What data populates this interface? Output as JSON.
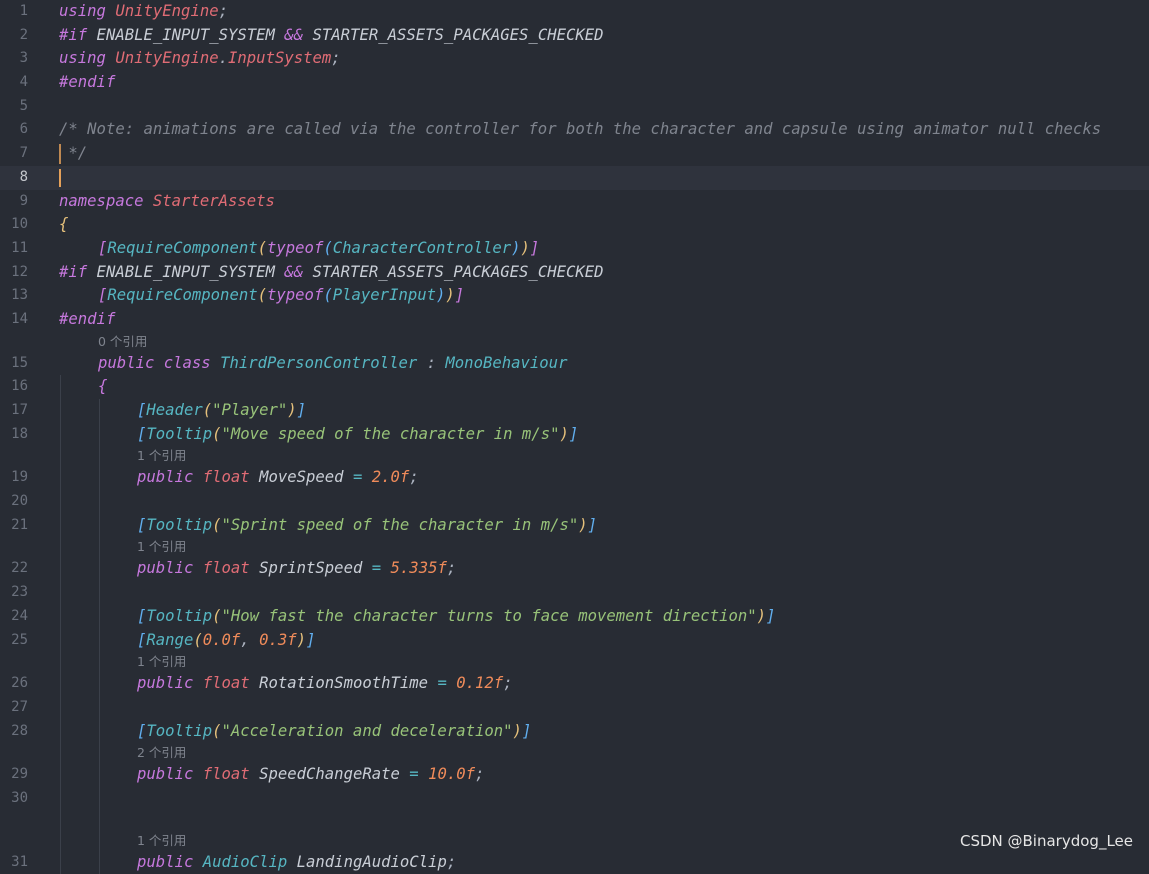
{
  "editor": {
    "current_line": "8",
    "lines": [
      {
        "num": "1",
        "indent": 0,
        "tokens": [
          {
            "t": "using",
            "c": "#c678dd"
          },
          {
            "t": " "
          },
          {
            "t": "UnityEngine",
            "c": "#e06c75"
          },
          {
            "t": ";",
            "c": "#abb2bf"
          }
        ]
      },
      {
        "num": "2",
        "indent": 0,
        "tokens": [
          {
            "t": "#if",
            "c": "#c678dd"
          },
          {
            "t": " ENABLE_INPUT_SYSTEM ",
            "c": "#c9ced6"
          },
          {
            "t": "&&",
            "c": "#c678dd"
          },
          {
            "t": " STARTER_ASSETS_PACKAGES_CHECKED",
            "c": "#c9ced6"
          }
        ]
      },
      {
        "num": "3",
        "indent": 0,
        "tokens": [
          {
            "t": "using",
            "c": "#c678dd"
          },
          {
            "t": " "
          },
          {
            "t": "UnityEngine",
            "c": "#e06c75"
          },
          {
            "t": ".",
            "c": "#abb2bf"
          },
          {
            "t": "InputSystem",
            "c": "#e06c75"
          },
          {
            "t": ";",
            "c": "#abb2bf"
          }
        ]
      },
      {
        "num": "4",
        "indent": 0,
        "tokens": [
          {
            "t": "#endif",
            "c": "#c678dd"
          }
        ]
      },
      {
        "num": "5",
        "indent": 0,
        "tokens": []
      },
      {
        "num": "6",
        "indent": 0,
        "tokens": [
          {
            "t": "/* Note: animations are called via the controller for both the character and capsule using animator null checks",
            "c": "#7f848e"
          }
        ]
      },
      {
        "num": "7",
        "indent": 0,
        "commentbar": true,
        "tokens": [
          {
            "t": " */",
            "c": "#7f848e"
          }
        ]
      },
      {
        "num": "8",
        "indent": 0,
        "current": true,
        "tokens": []
      },
      {
        "num": "9",
        "indent": 0,
        "tokens": [
          {
            "t": "namespace",
            "c": "#c678dd"
          },
          {
            "t": " "
          },
          {
            "t": "StarterAssets",
            "c": "#e06c75"
          }
        ]
      },
      {
        "num": "10",
        "indent": 0,
        "tokens": [
          {
            "t": "{",
            "c": "#e5c07b"
          }
        ]
      },
      {
        "num": "11",
        "indent": 1,
        "tokens": [
          {
            "t": "[",
            "c": "#c678dd"
          },
          {
            "t": "RequireComponent",
            "c": "#56b6c2"
          },
          {
            "t": "(",
            "c": "#e5c07b"
          },
          {
            "t": "typeof",
            "c": "#c678dd"
          },
          {
            "t": "(",
            "c": "#61afef"
          },
          {
            "t": "CharacterController",
            "c": "#56b6c2"
          },
          {
            "t": ")",
            "c": "#61afef"
          },
          {
            "t": ")",
            "c": "#e5c07b"
          },
          {
            "t": "]",
            "c": "#c678dd"
          }
        ]
      },
      {
        "num": "12",
        "indent": 0,
        "tokens": [
          {
            "t": "#if",
            "c": "#c678dd"
          },
          {
            "t": " ENABLE_INPUT_SYSTEM ",
            "c": "#c9ced6"
          },
          {
            "t": "&&",
            "c": "#c678dd"
          },
          {
            "t": " STARTER_ASSETS_PACKAGES_CHECKED",
            "c": "#c9ced6"
          }
        ]
      },
      {
        "num": "13",
        "indent": 1,
        "tokens": [
          {
            "t": "[",
            "c": "#c678dd"
          },
          {
            "t": "RequireComponent",
            "c": "#56b6c2"
          },
          {
            "t": "(",
            "c": "#e5c07b"
          },
          {
            "t": "typeof",
            "c": "#c678dd"
          },
          {
            "t": "(",
            "c": "#61afef"
          },
          {
            "t": "PlayerInput",
            "c": "#56b6c2"
          },
          {
            "t": ")",
            "c": "#61afef"
          },
          {
            "t": ")",
            "c": "#e5c07b"
          },
          {
            "t": "]",
            "c": "#c678dd"
          }
        ]
      },
      {
        "num": "14",
        "indent": 0,
        "tokens": [
          {
            "t": "#endif",
            "c": "#c678dd"
          }
        ]
      },
      {
        "lens": "0 个引用",
        "indent": 1,
        "guides": 0
      },
      {
        "num": "15",
        "indent": 1,
        "tokens": [
          {
            "t": "public",
            "c": "#c678dd"
          },
          {
            "t": " "
          },
          {
            "t": "class",
            "c": "#c678dd"
          },
          {
            "t": " "
          },
          {
            "t": "ThirdPersonController",
            "c": "#56b6c2"
          },
          {
            "t": " : ",
            "c": "#abb2bf"
          },
          {
            "t": "MonoBehaviour",
            "c": "#56b6c2"
          }
        ]
      },
      {
        "num": "16",
        "indent": 1,
        "guides": 1,
        "tokens": [
          {
            "t": "{",
            "c": "#c678dd"
          }
        ]
      },
      {
        "num": "17",
        "indent": 2,
        "guides": 2,
        "tokens": [
          {
            "t": "[",
            "c": "#61afef"
          },
          {
            "t": "Header",
            "c": "#56b6c2"
          },
          {
            "t": "(",
            "c": "#e5c07b"
          },
          {
            "t": "\"Player\"",
            "c": "#98c379"
          },
          {
            "t": ")",
            "c": "#e5c07b"
          },
          {
            "t": "]",
            "c": "#61afef"
          }
        ]
      },
      {
        "num": "18",
        "indent": 2,
        "guides": 2,
        "tokens": [
          {
            "t": "[",
            "c": "#61afef"
          },
          {
            "t": "Tooltip",
            "c": "#56b6c2"
          },
          {
            "t": "(",
            "c": "#e5c07b"
          },
          {
            "t": "\"Move speed of the character in m/s\"",
            "c": "#98c379"
          },
          {
            "t": ")",
            "c": "#e5c07b"
          },
          {
            "t": "]",
            "c": "#61afef"
          }
        ]
      },
      {
        "lens": "1 个引用",
        "indent": 2,
        "guides": 2
      },
      {
        "num": "19",
        "indent": 2,
        "guides": 2,
        "tokens": [
          {
            "t": "public",
            "c": "#c678dd"
          },
          {
            "t": " "
          },
          {
            "t": "float",
            "c": "#e06c75"
          },
          {
            "t": " MoveSpeed ",
            "c": "#c9ced6"
          },
          {
            "t": "=",
            "c": "#56b6c2"
          },
          {
            "t": " "
          },
          {
            "t": "2.0f",
            "c": "#ef8b5a"
          },
          {
            "t": ";",
            "c": "#abb2bf"
          }
        ]
      },
      {
        "num": "20",
        "indent": 2,
        "guides": 2,
        "tokens": []
      },
      {
        "num": "21",
        "indent": 2,
        "guides": 2,
        "tokens": [
          {
            "t": "[",
            "c": "#61afef"
          },
          {
            "t": "Tooltip",
            "c": "#56b6c2"
          },
          {
            "t": "(",
            "c": "#e5c07b"
          },
          {
            "t": "\"Sprint speed of the character in m/s\"",
            "c": "#98c379"
          },
          {
            "t": ")",
            "c": "#e5c07b"
          },
          {
            "t": "]",
            "c": "#61afef"
          }
        ]
      },
      {
        "lens": "1 个引用",
        "indent": 2,
        "guides": 2
      },
      {
        "num": "22",
        "indent": 2,
        "guides": 2,
        "tokens": [
          {
            "t": "public",
            "c": "#c678dd"
          },
          {
            "t": " "
          },
          {
            "t": "float",
            "c": "#e06c75"
          },
          {
            "t": " SprintSpeed ",
            "c": "#c9ced6"
          },
          {
            "t": "=",
            "c": "#56b6c2"
          },
          {
            "t": " "
          },
          {
            "t": "5.335f",
            "c": "#ef8b5a"
          },
          {
            "t": ";",
            "c": "#abb2bf"
          }
        ]
      },
      {
        "num": "23",
        "indent": 2,
        "guides": 2,
        "tokens": []
      },
      {
        "num": "24",
        "indent": 2,
        "guides": 2,
        "tokens": [
          {
            "t": "[",
            "c": "#61afef"
          },
          {
            "t": "Tooltip",
            "c": "#56b6c2"
          },
          {
            "t": "(",
            "c": "#e5c07b"
          },
          {
            "t": "\"How fast the character turns to face movement direction\"",
            "c": "#98c379"
          },
          {
            "t": ")",
            "c": "#e5c07b"
          },
          {
            "t": "]",
            "c": "#61afef"
          }
        ]
      },
      {
        "num": "25",
        "indent": 2,
        "guides": 2,
        "tokens": [
          {
            "t": "[",
            "c": "#61afef"
          },
          {
            "t": "Range",
            "c": "#56b6c2"
          },
          {
            "t": "(",
            "c": "#e5c07b"
          },
          {
            "t": "0.0f",
            "c": "#ef8b5a"
          },
          {
            "t": ", ",
            "c": "#abb2bf"
          },
          {
            "t": "0.3f",
            "c": "#ef8b5a"
          },
          {
            "t": ")",
            "c": "#e5c07b"
          },
          {
            "t": "]",
            "c": "#61afef"
          }
        ]
      },
      {
        "lens": "1 个引用",
        "indent": 2,
        "guides": 2
      },
      {
        "num": "26",
        "indent": 2,
        "guides": 2,
        "tokens": [
          {
            "t": "public",
            "c": "#c678dd"
          },
          {
            "t": " "
          },
          {
            "t": "float",
            "c": "#e06c75"
          },
          {
            "t": " RotationSmoothTime ",
            "c": "#c9ced6"
          },
          {
            "t": "=",
            "c": "#56b6c2"
          },
          {
            "t": " "
          },
          {
            "t": "0.12f",
            "c": "#ef8b5a"
          },
          {
            "t": ";",
            "c": "#abb2bf"
          }
        ]
      },
      {
        "num": "27",
        "indent": 2,
        "guides": 2,
        "tokens": []
      },
      {
        "num": "28",
        "indent": 2,
        "guides": 2,
        "tokens": [
          {
            "t": "[",
            "c": "#61afef"
          },
          {
            "t": "Tooltip",
            "c": "#56b6c2"
          },
          {
            "t": "(",
            "c": "#e5c07b"
          },
          {
            "t": "\"Acceleration and deceleration\"",
            "c": "#98c379"
          },
          {
            "t": ")",
            "c": "#e5c07b"
          },
          {
            "t": "]",
            "c": "#61afef"
          }
        ]
      },
      {
        "lens": "2 个引用",
        "indent": 2,
        "guides": 2
      },
      {
        "num": "29",
        "indent": 2,
        "guides": 2,
        "tokens": [
          {
            "t": "public",
            "c": "#c678dd"
          },
          {
            "t": " "
          },
          {
            "t": "float",
            "c": "#e06c75"
          },
          {
            "t": " SpeedChangeRate ",
            "c": "#c9ced6"
          },
          {
            "t": "=",
            "c": "#56b6c2"
          },
          {
            "t": " "
          },
          {
            "t": "10.0f",
            "c": "#ef8b5a"
          },
          {
            "t": ";",
            "c": "#abb2bf"
          }
        ]
      },
      {
        "num": "30",
        "indent": 2,
        "guides": 2,
        "tokens": []
      },
      {
        "lens": "",
        "indent": 2,
        "guides": 2
      },
      {
        "lens": "1 个引用",
        "indent": 2,
        "guides": 2
      },
      {
        "num": "31",
        "indent": 2,
        "guides": 2,
        "tokens": [
          {
            "t": "public",
            "c": "#c678dd"
          },
          {
            "t": " "
          },
          {
            "t": "AudioClip",
            "c": "#56b6c2"
          },
          {
            "t": " LandingAudioClip",
            "c": "#c9ced6"
          },
          {
            "t": ";",
            "c": "#abb2bf"
          }
        ]
      }
    ]
  },
  "watermark": "CSDN @Binarydog_Lee"
}
